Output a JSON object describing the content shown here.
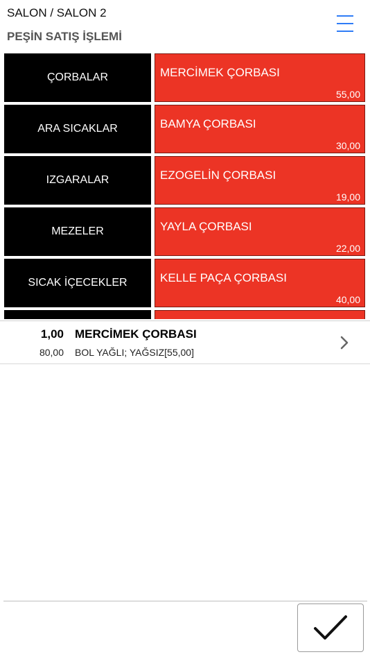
{
  "header": {
    "breadcrumb": "SALON / SALON 2",
    "title": "PEŞİN SATIŞ İŞLEMİ",
    "menu_icon": "hamburger-menu-icon",
    "accent_color": "#2f7cf6"
  },
  "categories": [
    {
      "label": "ÇORBALAR"
    },
    {
      "label": "ARA SICAKLAR"
    },
    {
      "label": "IZGARALAR"
    },
    {
      "label": "MEZELER"
    },
    {
      "label": "SICAK İÇECEKLER"
    }
  ],
  "products": [
    {
      "name": "MERCİMEK ÇORBASI",
      "price": "55,00"
    },
    {
      "name": "BAMYA ÇORBASI",
      "price": "30,00"
    },
    {
      "name": "EZOGELİN ÇORBASI",
      "price": "19,00"
    },
    {
      "name": "YAYLA ÇORBASI",
      "price": "22,00"
    },
    {
      "name": "KELLE PAÇA ÇORBASI",
      "price": "40,00"
    }
  ],
  "order": {
    "items": [
      {
        "quantity": "1,00",
        "name": "MERCİMEK ÇORBASI",
        "line_total": "80,00",
        "modifiers": "BOL YAĞLI; YAĞSIZ[55,00]"
      }
    ]
  },
  "footer": {
    "confirm_icon": "checkmark-icon"
  },
  "colors": {
    "category_bg": "#000000",
    "product_bg": "#ec3425"
  }
}
